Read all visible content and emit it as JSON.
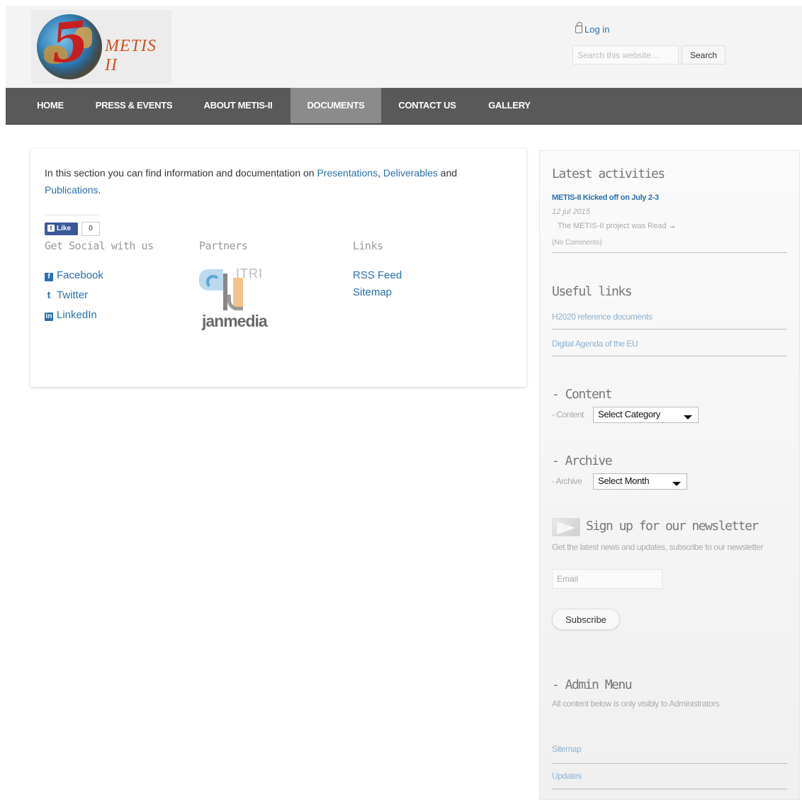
{
  "header": {
    "logo_text": "METIS II",
    "login_label": "Log in",
    "search": {
      "placeholder": "Search this website…",
      "button_label": "Search"
    }
  },
  "nav": {
    "items": [
      {
        "label": "HOME"
      },
      {
        "label": "PRESS & EVENTS"
      },
      {
        "label": "ABOUT METIS-II"
      },
      {
        "label": "DOCUMENTS",
        "active": true
      },
      {
        "label": "CONTACT US"
      },
      {
        "label": "GALLERY"
      }
    ],
    "bar_color": "#595959",
    "active_color": "#8b8b8b"
  },
  "main": {
    "intro_prefix": "In this section you can find information and documentation on ",
    "intro_link1": "Presentations",
    "intro_sep": ", ",
    "intro_link2": "Deliverables",
    "intro_mid": " and ",
    "intro_link3": "Publications",
    "intro_end": ".",
    "like_label": "Like",
    "like_count": "0",
    "social_heading": "Get Social with us",
    "partners_heading": "Partners",
    "links_heading": "Links",
    "social_links": [
      "Facebook",
      "Twitter",
      "LinkedIn"
    ],
    "partner_logos": {
      "itri_text": "ITRI",
      "janmedia_text": "janmedia"
    },
    "links": [
      "RSS Feed",
      "Sitemap"
    ]
  },
  "sidebar": {
    "latest_heading": "Latest activities",
    "activity": {
      "title": "METIS-II Kicked off on July 2-3",
      "date": "12 jul 2015",
      "excerpt": "The METIS-II project was Read",
      "comments": "(No Comments)"
    },
    "useful_heading": "Useful links",
    "useful_links": [
      "H2020 reference documents",
      "Digital Agenda of the EU"
    ],
    "content_heading": "- Content",
    "content_label": "- Content",
    "content_select": "Select Category",
    "archive_heading": "- Archive",
    "archive_label": "- Archive",
    "archive_select": "Select Month",
    "newsletter_heading": "Sign up for our newsletter",
    "newsletter_text": "Get the latest news and updates, subscribe to our newsletter",
    "email_placeholder": "Email",
    "subscribe_label": "Subscribe",
    "admin_heading": "- Admin Menu",
    "admin_note": "All content below is only visibly to Administrators",
    "admin_links": [
      "Sitemap",
      "Updates"
    ]
  },
  "colors": {
    "link": "#2a6fae",
    "accent_logo": "#c81e1e"
  }
}
